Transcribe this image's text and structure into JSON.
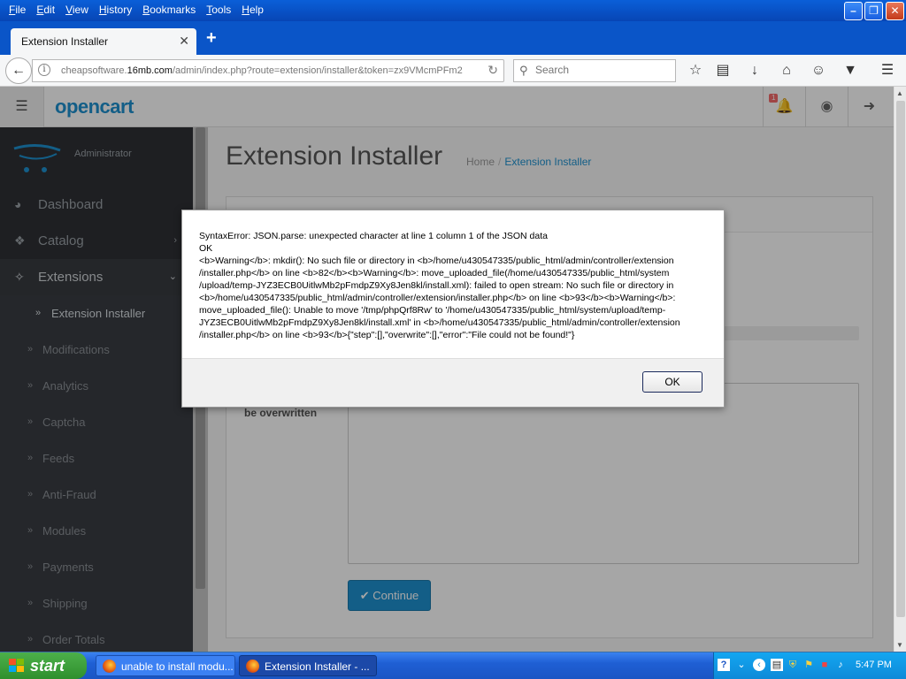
{
  "browser": {
    "menu": [
      "File",
      "Edit",
      "View",
      "History",
      "Bookmarks",
      "Tools",
      "Help"
    ],
    "tab_title": "Extension Installer",
    "url_prefix": "cheapsoftware.",
    "url_domain": "16mb.com",
    "url_rest": "/admin/index.php?route=extension/installer&token=zx9VMcmPFm2",
    "search_placeholder": "Search"
  },
  "opencart": {
    "logo": "opencart",
    "notification_count": "1",
    "user_name": "Administrator",
    "nav": [
      {
        "label": "Dashboard",
        "icon": "dashboard-icon"
      },
      {
        "label": "Catalog",
        "icon": "tag-icon"
      },
      {
        "label": "Extensions",
        "icon": "puzzle-icon"
      }
    ],
    "subnav": [
      "Extension Installer",
      "Modifications",
      "Analytics",
      "Captcha",
      "Feeds",
      "Anti-Fraud",
      "Modules",
      "Payments",
      "Shipping",
      "Order Totals"
    ],
    "page_title": "Extension Installer",
    "breadcrumb": [
      "Home",
      "Extension Installer"
    ],
    "overwrite_label": "be overwritten",
    "continue_label": "Continue"
  },
  "dialog": {
    "message": "SyntaxError: JSON.parse: unexpected character at line 1 column 1 of the JSON data\nOK\n<b>Warning</b>: mkdir(): No such file or directory in <b>/home/u430547335/public_html/admin/controller/extension\n/installer.php</b> on line <b>82</b><b>Warning</b>: move_uploaded_file(/home/u430547335/public_html/system\n/upload/temp-JYZ3ECB0UitlwMb2pFmdpZ9Xy8Jen8kl/install.xml): failed to open stream: No such file or directory in\n<b>/home/u430547335/public_html/admin/controller/extension/installer.php</b> on line <b>93</b><b>Warning</b>:\nmove_uploaded_file(): Unable to move '/tmp/phpQrf8Rw' to '/home/u430547335/public_html/system/upload/temp-\nJYZ3ECB0UitlwMb2pFmdpZ9Xy8Jen8kl/install.xml' in <b>/home/u430547335/public_html/admin/controller/extension\n/installer.php</b> on line <b>93</b>{\"step\":[],\"overwrite\":[],\"error\":\"File could not be found!\"}",
    "ok_label": "OK"
  },
  "taskbar": {
    "start_label": "start",
    "tasks": [
      "unable to install modu...",
      "Extension Installer - ..."
    ],
    "clock": "5:47 PM"
  }
}
